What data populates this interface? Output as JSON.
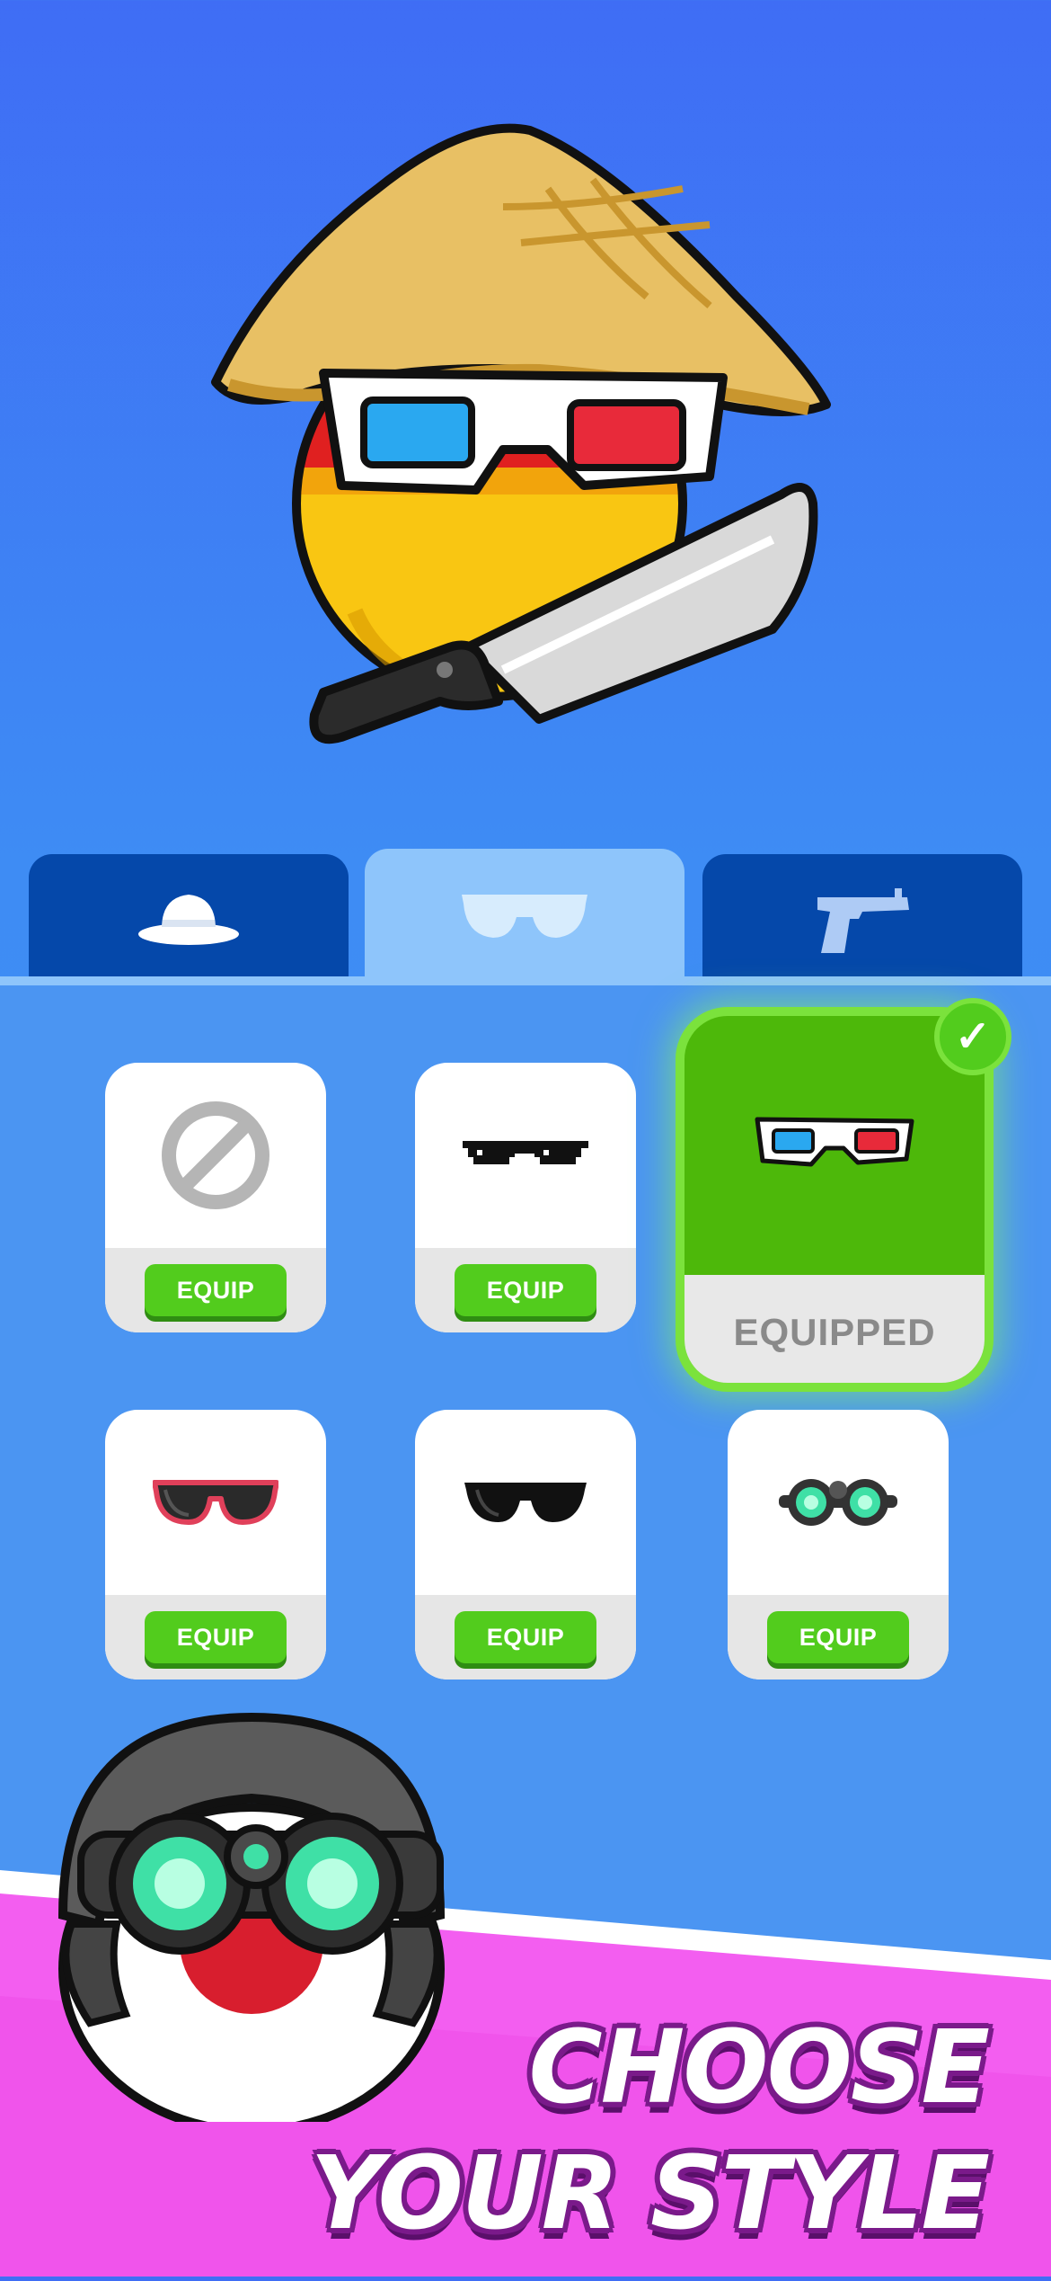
{
  "hero": {
    "character": "countryball-red-yellow",
    "hat_icon": "conical-straw-hat-icon",
    "glasses_icon": "3d-glasses-icon",
    "weapon_icon": "machete-icon"
  },
  "tabs": [
    {
      "id": "hats",
      "icon": "hat-icon",
      "active": false
    },
    {
      "id": "glasses",
      "icon": "sunglasses-icon",
      "active": true
    },
    {
      "id": "weapons",
      "icon": "pistol-icon",
      "active": false
    }
  ],
  "items": [
    {
      "icon": "none-icon",
      "button": "EQUIP"
    },
    {
      "icon": "pixel-sunglasses-icon",
      "button": "EQUIP"
    },
    {
      "icon": "3d-glasses-icon",
      "status": "EQUIPPED"
    },
    {
      "icon": "red-frame-sunglasses-icon",
      "button": "EQUIP"
    },
    {
      "icon": "black-sunglasses-icon",
      "button": "EQUIP"
    },
    {
      "icon": "night-vision-goggles-icon",
      "button": "EQUIP"
    }
  ],
  "banner": {
    "line1": "CHOOSE",
    "line2": "YOUR STYLE",
    "mascot_icon": "countryball-with-night-vision-helmet-icon"
  },
  "colors": {
    "accent_green": "#52cc1d",
    "tab_dark": "#0548aa",
    "tab_active": "#8ec5fb",
    "banner_pink": "#f35ef0"
  }
}
